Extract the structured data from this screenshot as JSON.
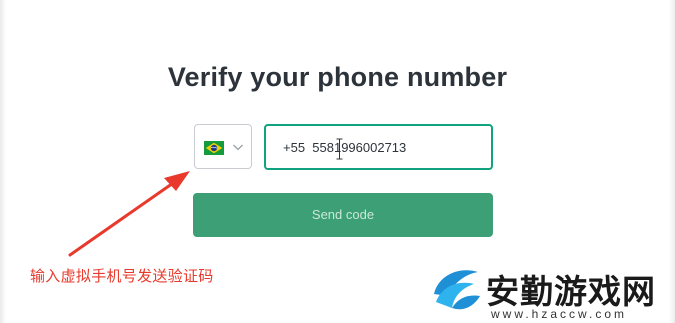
{
  "page": {
    "title": "Verify your phone number"
  },
  "country_select": {
    "selected_country": "Brazil",
    "flag_icon": "brazil-flag-icon",
    "chevron_icon": "chevron-down-icon"
  },
  "phone_input": {
    "value": "+55  5581996002713"
  },
  "send_button": {
    "label": "Send code",
    "color": "#3d9f76"
  },
  "annotation": {
    "text": "输入虚拟手机号发送验证码",
    "color": "#e8392c"
  },
  "watermark": {
    "title": "安勤游戏网",
    "domain": "www.hzaccw.com"
  },
  "colors": {
    "accent": "#10a37f",
    "title_text": "#2d333a"
  }
}
